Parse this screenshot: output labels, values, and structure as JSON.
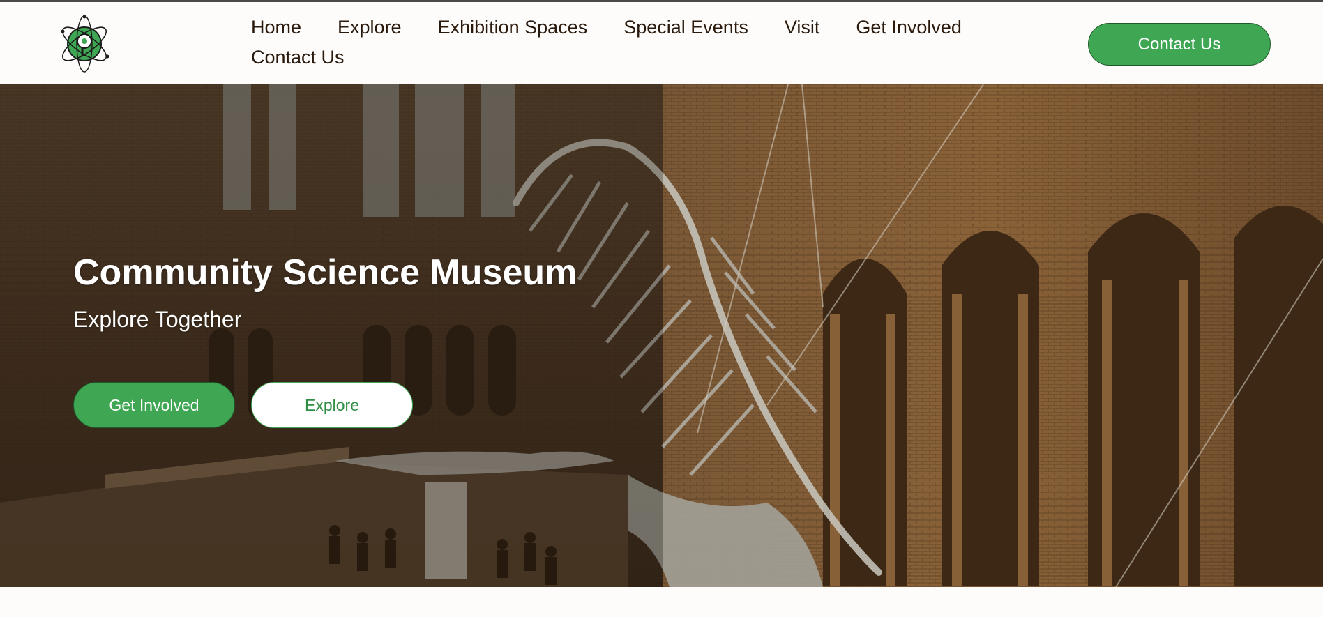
{
  "header": {
    "logo_icon": "atom-logo-icon",
    "nav_items": [
      {
        "label": "Home"
      },
      {
        "label": "Explore"
      },
      {
        "label": "Exhibition Spaces"
      },
      {
        "label": "Special Events"
      },
      {
        "label": "Visit"
      },
      {
        "label": "Get Involved"
      },
      {
        "label": "Contact Us"
      }
    ],
    "contact_button": "Contact Us"
  },
  "hero": {
    "title": "Community Science Museum",
    "subtitle": "Explore Together",
    "primary_button": "Get Involved",
    "secondary_button": "Explore",
    "background": "museum-hall-whale-skeleton-image"
  },
  "colors": {
    "accent_green": "#3fa753",
    "dark_green": "#1f5a2a",
    "text_dark": "#2a1a0e",
    "page_bg": "#fdfcfa"
  }
}
